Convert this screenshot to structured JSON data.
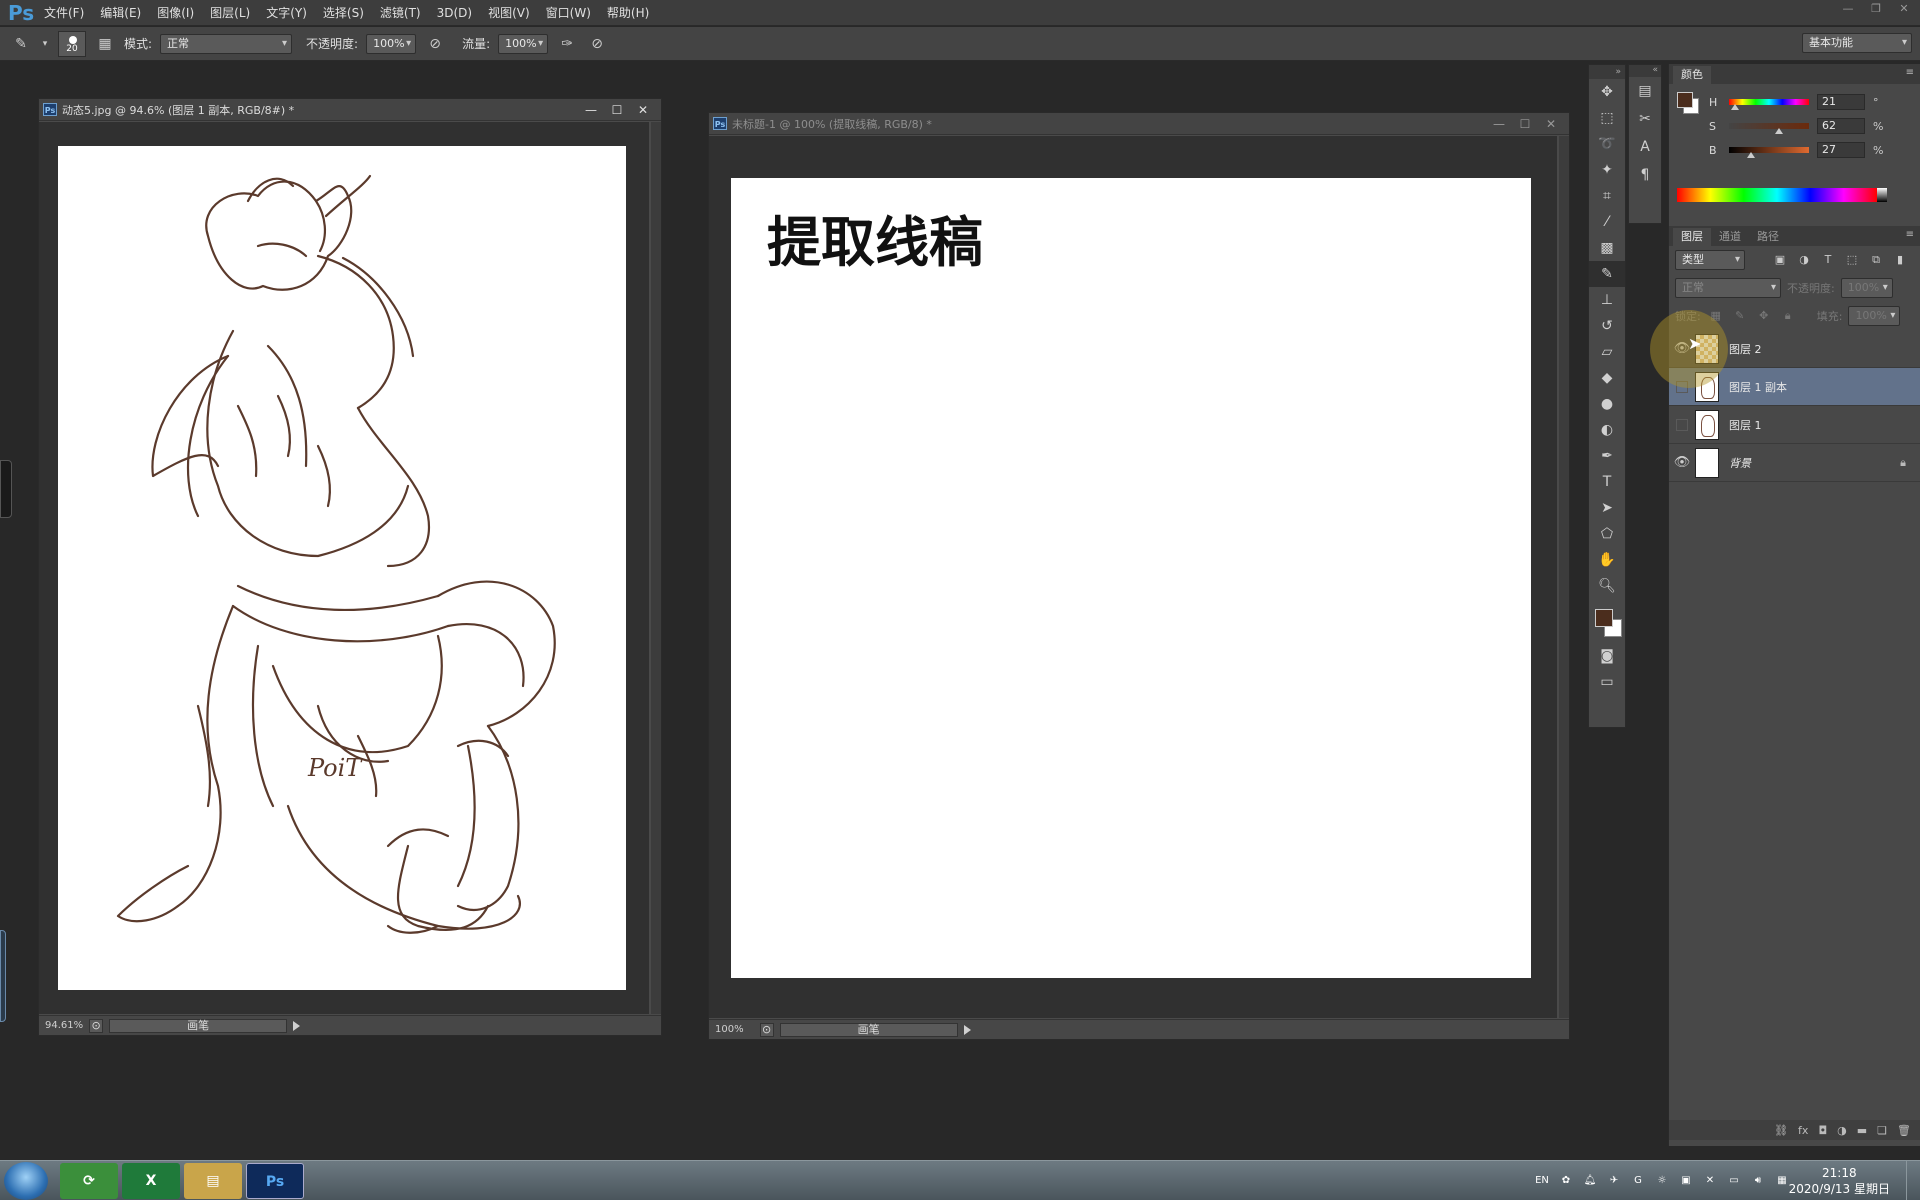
{
  "menubar": {
    "logo": "Ps",
    "items": [
      "文件(F)",
      "编辑(E)",
      "图像(I)",
      "图层(L)",
      "文字(Y)",
      "选择(S)",
      "滤镜(T)",
      "3D(D)",
      "视图(V)",
      "窗口(W)",
      "帮助(H)"
    ]
  },
  "options": {
    "brush_size": "20",
    "mode_label": "模式:",
    "mode_value": "正常",
    "opacity_label": "不透明度:",
    "opacity_value": "100%",
    "flow_label": "流量:",
    "flow_value": "100%",
    "workspace": "基本功能"
  },
  "doc1": {
    "title": "动态5.jpg @ 94.6% (图层 1 副本, RGB/8#) *",
    "zoom": "94.61%",
    "status": "画笔"
  },
  "doc2": {
    "title": "未标题-1 @ 100% (提取线稿, RGB/8) *",
    "canvas_text": "提取线稿",
    "zoom": "100%",
    "status": "画笔"
  },
  "color_panel": {
    "tab": "颜色",
    "foreground": "#4b2d1d",
    "background": "#ffffff",
    "h_label": "H",
    "h_value": "21",
    "h_unit": "°",
    "s_label": "S",
    "s_value": "62",
    "s_unit": "%",
    "b_label": "B",
    "b_value": "27",
    "b_unit": "%"
  },
  "layers_panel": {
    "tabs": [
      "图层",
      "通道",
      "路径"
    ],
    "filter": "类型",
    "blend": "正常",
    "opacity_label": "不透明度:",
    "opacity_value": "100%",
    "lock_label": "锁定:",
    "fill_label": "填充:",
    "fill_value": "100%",
    "layers": [
      {
        "name": "图层 2",
        "visible": true,
        "selected": false
      },
      {
        "name": "图层 1 副本",
        "visible": false,
        "selected": true
      },
      {
        "name": "图层 1",
        "visible": false,
        "selected": false
      },
      {
        "name": "背景",
        "visible": true,
        "selected": false,
        "locked": true
      }
    ]
  },
  "taskbar": {
    "time": "21:18",
    "date": "2020/9/13 星期日",
    "lang": "EN"
  },
  "colors": {
    "accent": "#4a9bd8",
    "selected_layer": "#62728b",
    "foreground_color": "#4b2d1d"
  }
}
